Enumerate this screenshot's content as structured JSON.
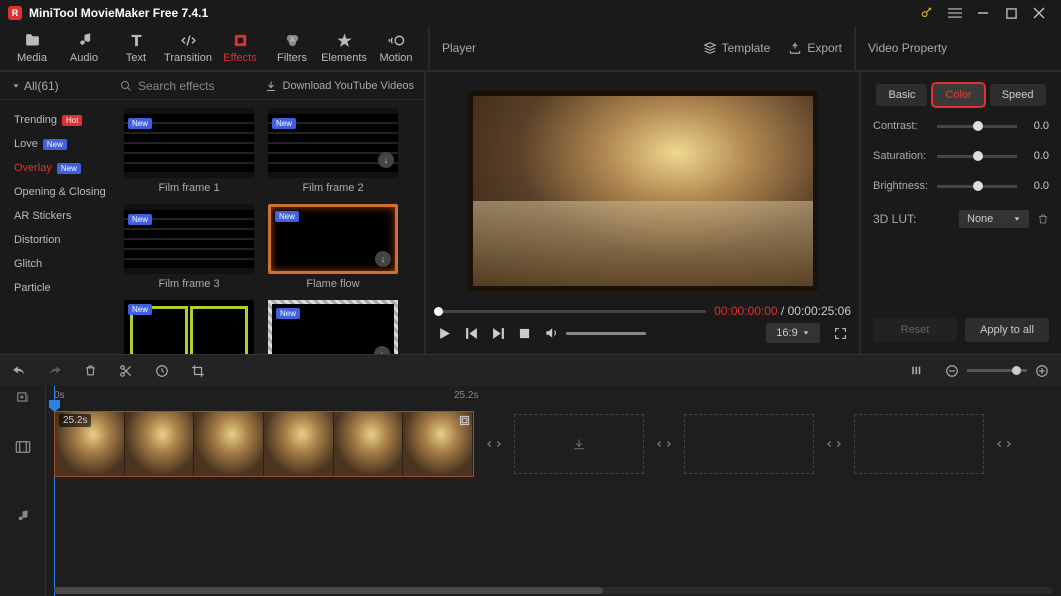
{
  "app": {
    "title": "MiniTool MovieMaker Free 7.4.1"
  },
  "mainTabs": [
    {
      "id": "media",
      "label": "Media"
    },
    {
      "id": "audio",
      "label": "Audio"
    },
    {
      "id": "text",
      "label": "Text"
    },
    {
      "id": "transition",
      "label": "Transition"
    },
    {
      "id": "effects",
      "label": "Effects"
    },
    {
      "id": "filters",
      "label": "Filters"
    },
    {
      "id": "elements",
      "label": "Elements"
    },
    {
      "id": "motion",
      "label": "Motion"
    }
  ],
  "activeMainTab": "effects",
  "playerHeader": {
    "title": "Player",
    "template": "Template",
    "export": "Export"
  },
  "propsHeader": "Video Property",
  "effects": {
    "allLabel": "All(61)",
    "searchPlaceholder": "Search effects",
    "downloadLabel": "Download YouTube Videos",
    "categories": [
      {
        "label": "Trending",
        "badge": "Hot",
        "badgeClass": "hot"
      },
      {
        "label": "Love",
        "badge": "New",
        "badgeClass": "new"
      },
      {
        "label": "Overlay",
        "badge": "New",
        "badgeClass": "new",
        "active": true
      },
      {
        "label": "Opening & Closing"
      },
      {
        "label": "AR Stickers"
      },
      {
        "label": "Distortion"
      },
      {
        "label": "Glitch"
      },
      {
        "label": "Particle"
      }
    ],
    "items": [
      {
        "name": "Film frame 1",
        "thumb": "filmframe",
        "new": true
      },
      {
        "name": "Film frame 2",
        "thumb": "filmframe",
        "new": true,
        "dl": true
      },
      {
        "name": "Film frame 3",
        "thumb": "filmframe",
        "new": true
      },
      {
        "name": "Flame flow",
        "thumb": "flame",
        "new": true,
        "dl": true
      },
      {
        "name": "",
        "thumb": "greensplit",
        "new": true
      },
      {
        "name": "",
        "thumb": "torn",
        "new": true,
        "dl": true
      }
    ]
  },
  "player": {
    "currentTime": "00:00:00:00",
    "sep": " / ",
    "totalTime": "00:00:25:06",
    "ratio": "16:9"
  },
  "props": {
    "tabs": [
      {
        "label": "Basic"
      },
      {
        "label": "Color",
        "active": true
      },
      {
        "label": "Speed"
      }
    ],
    "rows": [
      {
        "label": "Contrast:",
        "value": "0.0"
      },
      {
        "label": "Saturation:",
        "value": "0.0"
      },
      {
        "label": "Brightness:",
        "value": "0.0"
      }
    ],
    "lutLabel": "3D LUT:",
    "lutValue": "None",
    "reset": "Reset",
    "apply": "Apply to all"
  },
  "timeline": {
    "ruler": [
      {
        "pos": 8,
        "label": "0s"
      },
      {
        "pos": 408,
        "label": "25.2s"
      }
    ],
    "clipDuration": "25.2s"
  }
}
